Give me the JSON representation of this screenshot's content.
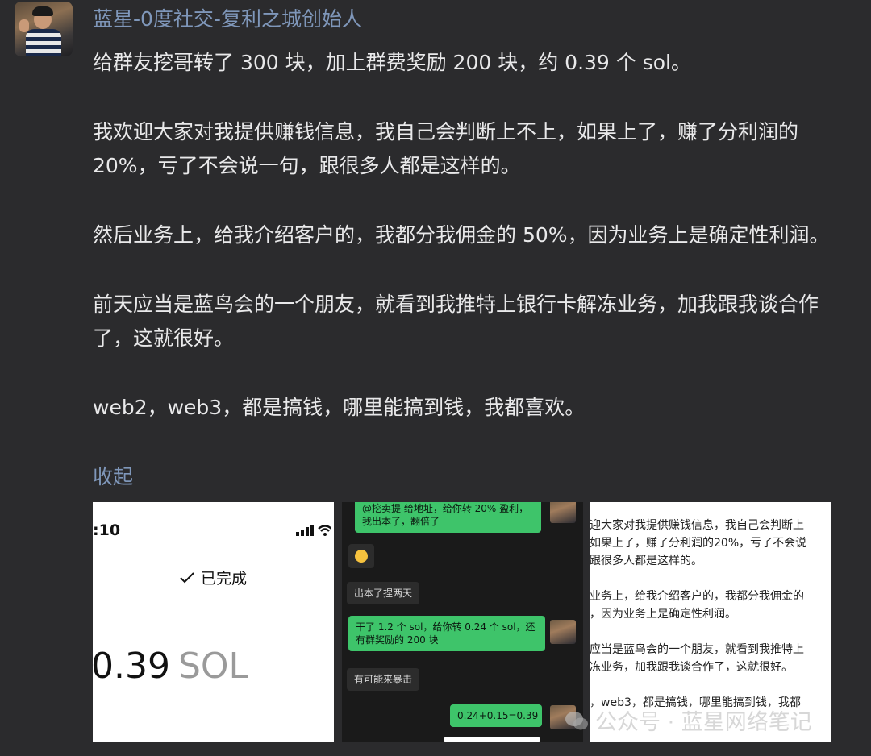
{
  "post": {
    "username": "蓝星-0度社交-复利之城创始人",
    "paragraphs": [
      "给群友挖哥转了 300 块，加上群费奖励 200 块，约 0.39 个 sol。",
      "我欢迎大家对我提供赚钱信息，我自己会判断上不上，如果上了，赚了分利润的 20%，亏了不会说一句，跟很多人都是这样的。",
      "然后业务上，给我介绍客户的，我都分我佣金的 50%，因为业务上是确定性利润。",
      "前天应当是蓝鸟会的一个朋友，就看到我推特上银行卡解冻业务，加我跟我谈合作了，这就很好。",
      "web2，web3，都是搞钱，哪里能搞到钱，我都喜欢。"
    ],
    "collapse_label": "收起"
  },
  "screenshot1": {
    "time": ":10",
    "status": "已完成",
    "amount": "0.39",
    "unit": "SOL"
  },
  "screenshot2": {
    "messages": [
      {
        "text": "@挖卖提 给地址，给你转 20% 盈利，我出本了，翻倍了"
      },
      {
        "text": "出本了捏两天"
      },
      {
        "text": "干了 1.2 个 sol，给你转 0.24 个 sol，还有群奖励的 200 块"
      },
      {
        "text": "有可能来暴击"
      },
      {
        "text": "0.24+0.15=0.39"
      }
    ]
  },
  "screenshot3": {
    "paragraphs": [
      [
        "迎大家对我提供赚钱信息，我自己会判断上",
        "如果上了，赚了分利润的20%，亏了不会说",
        "跟很多人都是这样的。"
      ],
      [
        "业务上，给我介绍客户的，我都分我佣金的",
        "，因为业务上是确定性利润。"
      ],
      [
        "应当是蓝鸟会的一个朋友，就看到我推特上",
        "冻业务，加我跟我谈合作了，这就很好。"
      ],
      [
        "，web3，都是搞钱，哪里能搞到钱，我都"
      ]
    ]
  },
  "watermark": {
    "text": "公众号 · 蓝星网络笔记"
  },
  "colors": {
    "background": "#2b2b2d",
    "link": "#7f97ba",
    "text": "#e9e9ea",
    "wechat_green": "#3ec46a"
  }
}
